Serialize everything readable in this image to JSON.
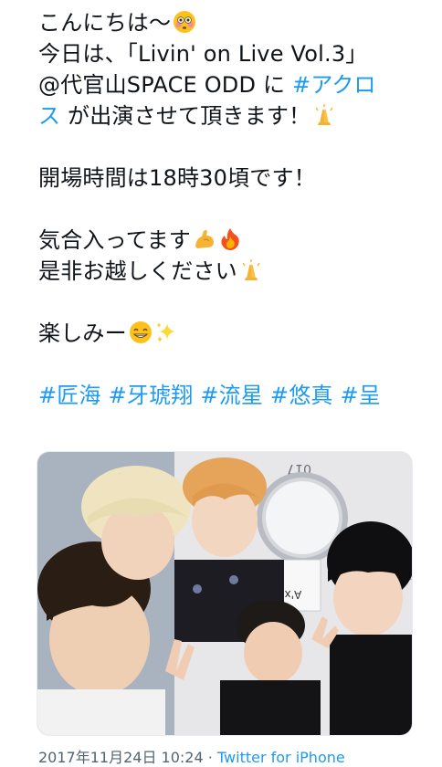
{
  "tweet": {
    "line1": "こんにちは〜",
    "line2": "今日は、「Livin' on Live Vol.3」",
    "line3a": "@代官山SPACE ODD に ",
    "line3_tag": "#アクロ",
    "line4_tag": "ス",
    "line4b": " が出演させて頂きます！",
    "line6": "開場時間は18時30頃です！",
    "line8": "気合入ってます",
    "line9": "是非お越しください",
    "line11": "楽しみー",
    "hashtags": [
      "#匠海",
      "#牙琥翔",
      "#流星",
      "#悠真",
      "#呈"
    ],
    "emoji": {
      "flushed": "flushed-face-icon",
      "pray": "folded-hands-icon",
      "muscle": "flexed-biceps-icon",
      "fire": "fire-icon",
      "grin": "grinning-face-icon",
      "sparkles": "sparkles-icon"
    }
  },
  "photo": {
    "door_number": "017",
    "nameplate": "A'x-d 様"
  },
  "meta": {
    "timestamp": "2017年11月24日 10:24",
    "separator": " · ",
    "source": "Twitter for iPhone"
  },
  "colors": {
    "link": "#1d9bf0",
    "text": "#0f1419",
    "muted": "#536471"
  }
}
